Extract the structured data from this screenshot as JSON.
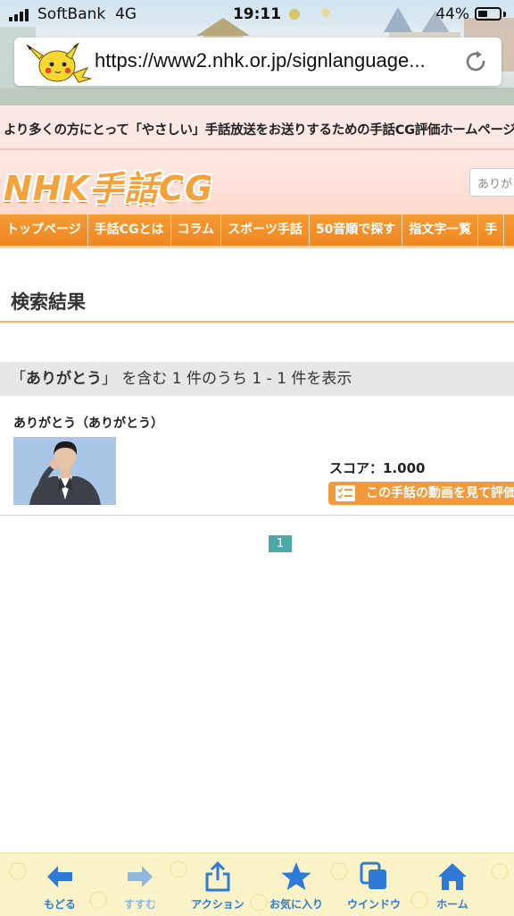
{
  "status_bar": {
    "carrier": "SoftBank",
    "network": "4G",
    "time": "19:11",
    "battery_percent_label": "44%",
    "battery_level": 0.44
  },
  "browser": {
    "url": "https://www2.nhk.or.jp/signlanguage/...",
    "url_display": "https://www2.nhk.or.jp/signlanguage..."
  },
  "site": {
    "tagline": "より多くの方にとって「やさしい」手話放送をお送りするための手話CG評価ホームページ",
    "logo_text": "NHK手話CG",
    "search_value": "ありがとう",
    "nav": [
      "トップページ",
      "手話CGとは",
      "コラム",
      "スポーツ手話",
      "50音順で探す",
      "指文字一覧",
      "手"
    ]
  },
  "main": {
    "heading": "検索結果",
    "result_summary": {
      "open_quote": "「",
      "query": "ありがとう",
      "close_quote": "」",
      "text": "を含む 1 件のうち 1 - 1 件を表示"
    },
    "result": {
      "title": "ありがとう（ありがとう）",
      "score": "スコア：1.000",
      "eval_button": "この手話の動画を見て評価"
    },
    "pagination": {
      "current": "1"
    }
  },
  "toolbar": {
    "back": "もどる",
    "forward": "すすむ",
    "action": "アクション",
    "favorites": "お気に入り",
    "window": "ウインドウ",
    "home": "ホーム"
  },
  "colors": {
    "nav_orange": "#f59b34",
    "link_blue": "#2d7bd6",
    "page_teal": "#4fa8a8"
  }
}
